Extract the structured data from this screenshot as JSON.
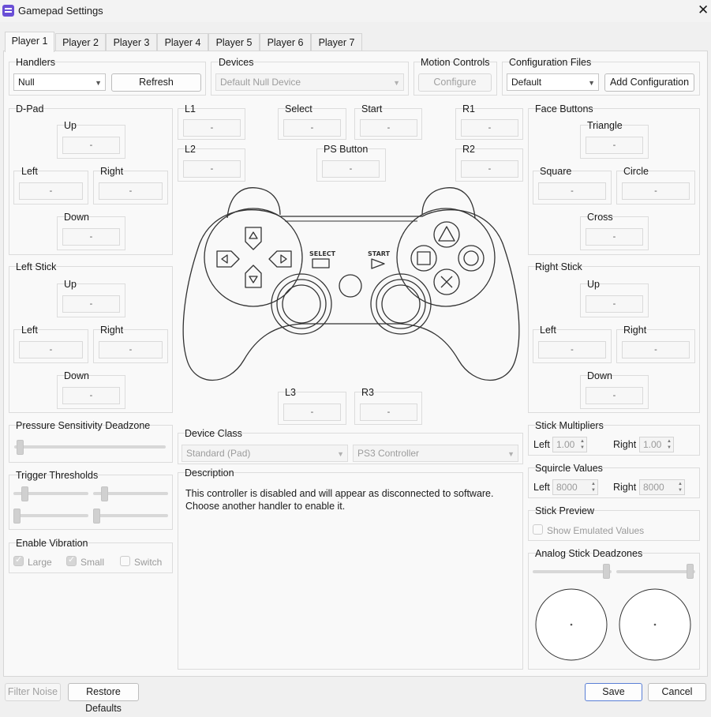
{
  "window": {
    "title": "Gamepad Settings",
    "close": "✕"
  },
  "tabs": [
    "Player 1",
    "Player 2",
    "Player 3",
    "Player 4",
    "Player 5",
    "Player 6",
    "Player 7"
  ],
  "handlers": {
    "title": "Handlers",
    "value": "Null",
    "refresh": "Refresh"
  },
  "devices": {
    "title": "Devices",
    "value": "Default Null Device"
  },
  "motion": {
    "title": "Motion Controls",
    "configure": "Configure"
  },
  "config_files": {
    "title": "Configuration Files",
    "value": "Default",
    "add": "Add Configuration"
  },
  "unbound": "-",
  "dpad": {
    "title": "D-Pad",
    "up": "Up",
    "left": "Left",
    "right": "Right",
    "down": "Down"
  },
  "left_stick": {
    "title": "Left Stick",
    "up": "Up",
    "left": "Left",
    "right": "Right",
    "down": "Down"
  },
  "shoulders": {
    "l1": "L1",
    "l2": "L2",
    "r1": "R1",
    "r2": "R2",
    "l3": "L3",
    "r3": "R3"
  },
  "center": {
    "select": "Select",
    "start": "Start",
    "ps": "PS Button"
  },
  "face": {
    "title": "Face Buttons",
    "triangle": "Triangle",
    "square": "Square",
    "circle": "Circle",
    "cross": "Cross"
  },
  "right_stick": {
    "title": "Right Stick",
    "up": "Up",
    "left": "Left",
    "right": "Right",
    "down": "Down"
  },
  "controller_art": {
    "select_label": "SELECT",
    "start_label": "START"
  },
  "pressure": {
    "title": "Pressure Sensitivity Deadzone",
    "value": 0
  },
  "triggers": {
    "title": "Trigger Thresholds"
  },
  "vibration": {
    "title": "Enable Vibration",
    "large": "Large",
    "small": "Small",
    "switch": "Switch",
    "large_checked": true,
    "small_checked": true,
    "switch_checked": false
  },
  "device_class": {
    "title": "Device Class",
    "class_value": "Standard (Pad)",
    "type_value": "PS3 Controller"
  },
  "description": {
    "title": "Description",
    "text": "This controller is disabled and will appear as disconnected to software. Choose another handler to enable it."
  },
  "stick_multipliers": {
    "title": "Stick Multipliers",
    "left_label": "Left",
    "left_value": "1.00",
    "right_label": "Right",
    "right_value": "1.00"
  },
  "squircle": {
    "title": "Squircle Values",
    "left_label": "Left",
    "left_value": "8000",
    "right_label": "Right",
    "right_value": "8000"
  },
  "stick_preview": {
    "title": "Stick Preview",
    "show_emulated": "Show Emulated Values",
    "checked": false
  },
  "analog_deadzones": {
    "title": "Analog Stick Deadzones"
  },
  "footer": {
    "filter_noise": "Filter Noise",
    "restore": "Restore Defaults",
    "save": "Save",
    "cancel": "Cancel"
  },
  "colors": {
    "accent": "#5a7fd6",
    "app_icon": "#6a4fd6"
  }
}
